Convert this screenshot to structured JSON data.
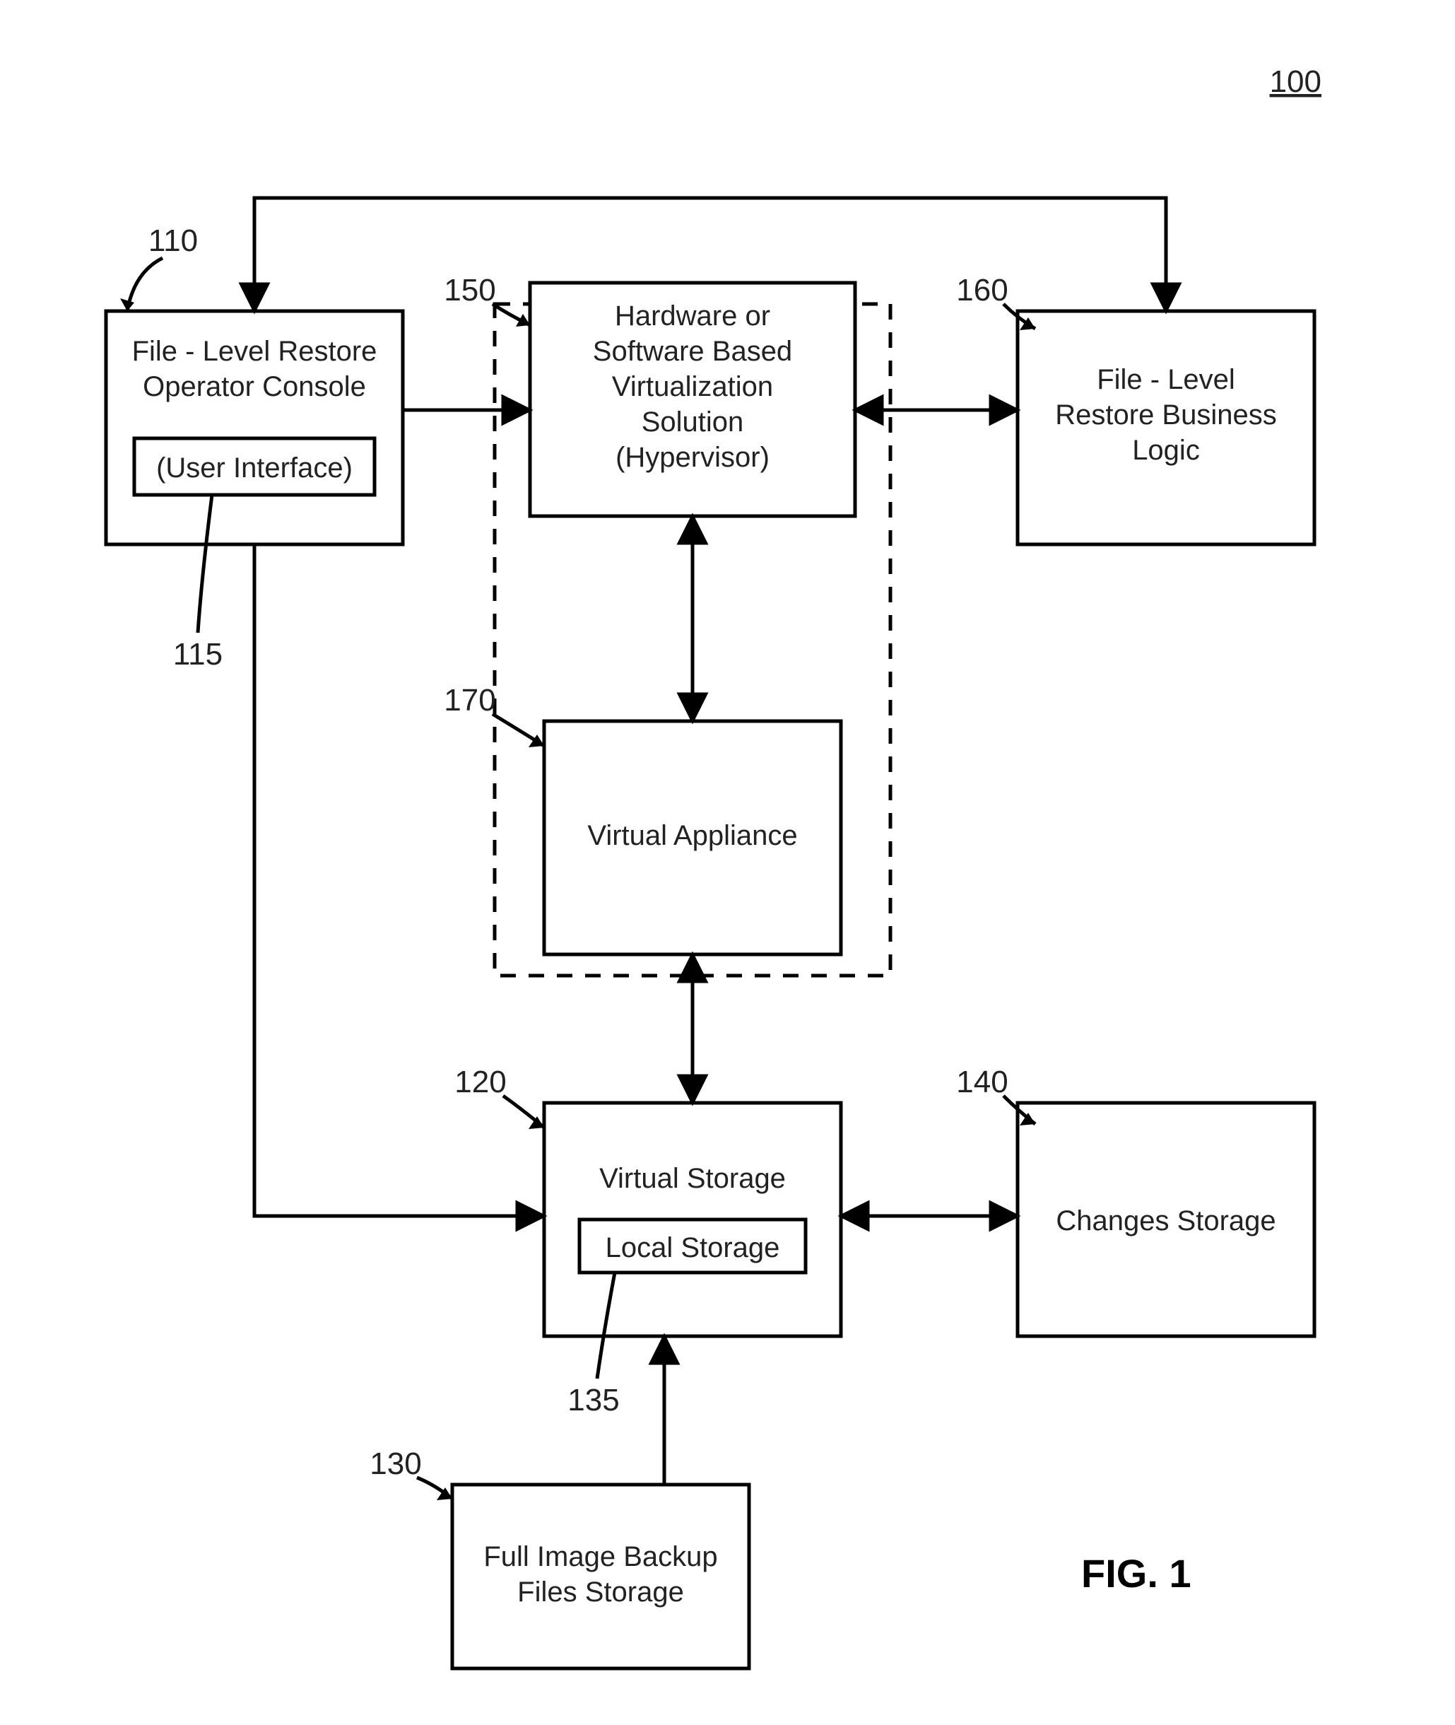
{
  "figure": {
    "ref_top": "100",
    "caption": "FIG. 1"
  },
  "refs": {
    "console": "110",
    "ui": "115",
    "virtual_storage": "120",
    "backup_storage": "130",
    "local_storage": "135",
    "changes_storage": "140",
    "hypervisor": "150",
    "business_logic": "160",
    "virtual_appliance": "170"
  },
  "boxes": {
    "console": {
      "line1": "File - Level Restore",
      "line2": "Operator Console",
      "inner": "(User Interface)"
    },
    "hypervisor": {
      "line1": "Hardware or",
      "line2": "Software Based",
      "line3": "Virtualization",
      "line4": "Solution",
      "line5": "(Hypervisor)"
    },
    "business_logic": {
      "line1": "File - Level",
      "line2": "Restore Business",
      "line3": "Logic"
    },
    "virtual_appliance": "Virtual Appliance",
    "virtual_storage": {
      "title": "Virtual Storage",
      "inner": "Local Storage"
    },
    "changes_storage": "Changes Storage",
    "backup_storage": {
      "line1": "Full Image Backup",
      "line2": "Files Storage"
    }
  }
}
